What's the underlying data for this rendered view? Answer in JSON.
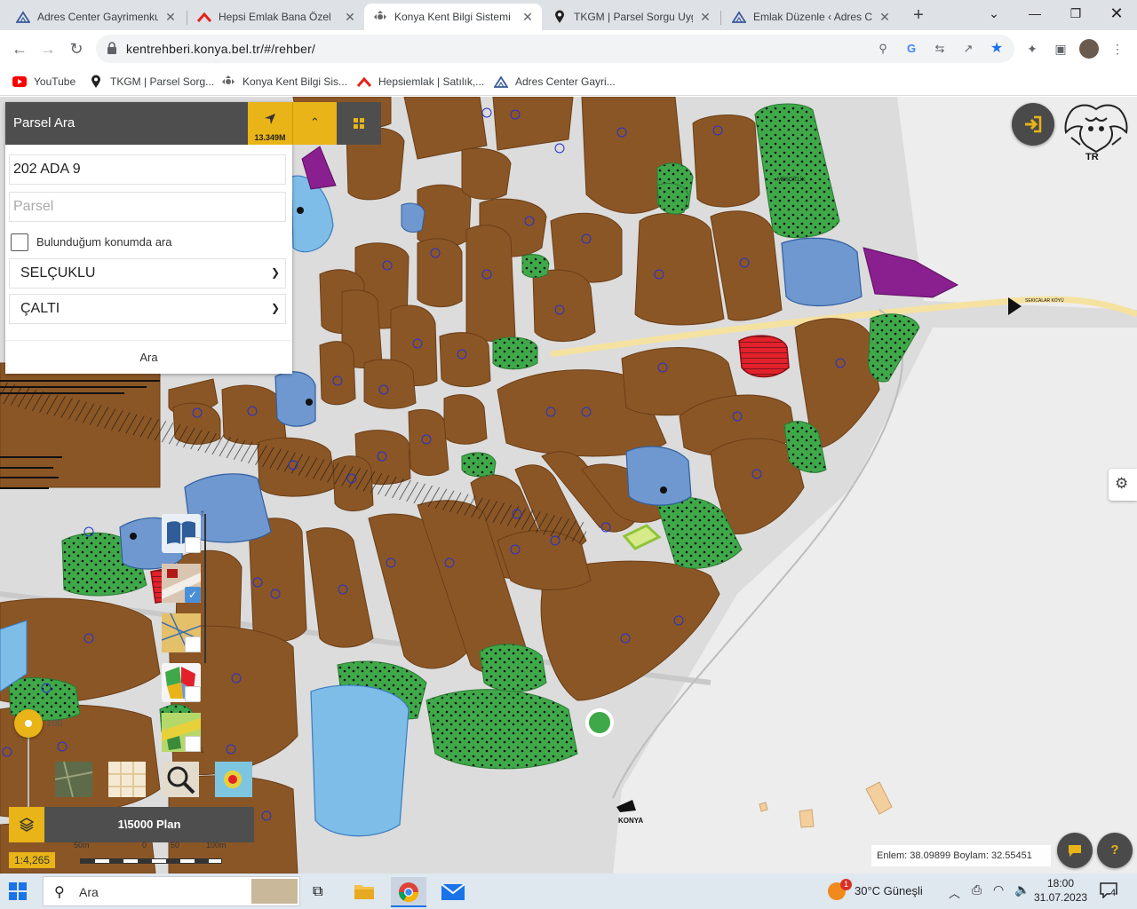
{
  "browser": {
    "tabs": [
      {
        "label": "Adres Center Gayrimenkul",
        "icon": "adres-center-icon",
        "active": false
      },
      {
        "label": "Hepsi Emlak Bana Özel",
        "icon": "hepsiemlak-icon",
        "active": false
      },
      {
        "label": "Konya Kent Bilgi Sistemi",
        "icon": "konya-kbs-icon",
        "active": true
      },
      {
        "label": "TKGM | Parsel Sorgu Uyg",
        "icon": "location-pin-icon",
        "active": false
      },
      {
        "label": "Emlak Düzenle ‹ Adres Ce",
        "icon": "adres-center-icon",
        "active": false
      }
    ],
    "url": "kentrehberi.konya.bel.tr/#/rehber/",
    "bookmarks": [
      {
        "label": "YouTube",
        "icon": "youtube-icon"
      },
      {
        "label": "TKGM | Parsel Sorg...",
        "icon": "location-pin-icon"
      },
      {
        "label": "Konya Kent Bilgi Sis...",
        "icon": "konya-kbs-icon"
      },
      {
        "label": "Hepsiemlak | Satılık,...",
        "icon": "hepsiemlak-icon"
      },
      {
        "label": "Adres Center Gayri...",
        "icon": "adres-center-icon"
      }
    ]
  },
  "panel": {
    "title": "Parsel Ara",
    "location_value": "13.349M",
    "ada_value": "202 ADA 9",
    "parsel_placeholder": "Parsel",
    "checkbox_label": "Bulunduğum konumda ara",
    "district": "SELÇUKLU",
    "neighborhood": "ÇALTI",
    "search_button": "Ara"
  },
  "map": {
    "emblem_label": "TR",
    "opacity_value": "100",
    "plan_label": "1\\5000 Plan",
    "scale": "1:4,265",
    "scalebar_labels": [
      "50m",
      "0",
      "50",
      "100m"
    ],
    "coordinates": "Enlem: 38.09899 Boylam: 32.55451",
    "place_labels": [
      "KONYA",
      "SEKICALAR KÖYÜ",
      "MESCİTLİK"
    ],
    "help_label": "?",
    "accent_color": "#e8b417",
    "parcel_color": "#8b5626",
    "green_color": "#3fa94a",
    "water_color": "#7dbde8"
  },
  "taskbar": {
    "search_placeholder": "Ara",
    "weather": "30°C  Güneşli",
    "weather_badge": "1",
    "time": "18:00",
    "date": "31.07.2023",
    "notifications": "4"
  }
}
